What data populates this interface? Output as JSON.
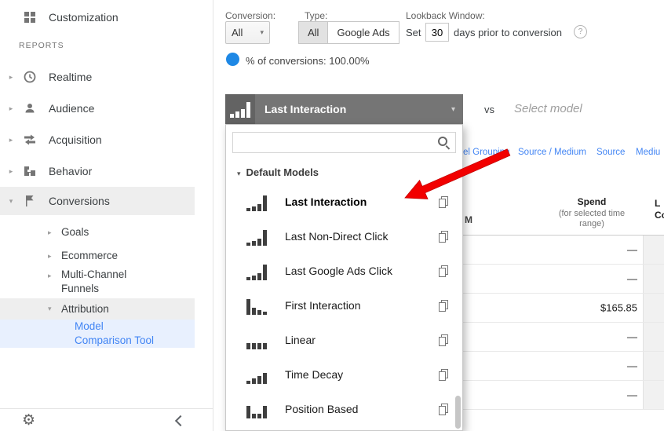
{
  "colors": {
    "link_blue": "#4285f4",
    "active_item_bg": "#e8f0fe",
    "selected_row_bg": "#eeeeee",
    "selector_header_gray": "#757575",
    "conversions_dot_blue": "#1e88e5",
    "annotation_arrow_red": "#f20000"
  },
  "sidebar": {
    "customization": "Customization",
    "reports_heading": "REPORTS",
    "realtime": "Realtime",
    "audience": "Audience",
    "acquisition": "Acquisition",
    "behavior": "Behavior",
    "conversions": "Conversions",
    "goals": "Goals",
    "ecommerce": "Ecommerce",
    "multi_channel_funnels": "Multi-Channel Funnels",
    "attribution": "Attribution",
    "model_comparison_tool": "Model Comparison Tool"
  },
  "toolbar": {
    "conversion_label": "Conversion:",
    "conversion_value": "All",
    "type_label": "Type:",
    "type_all": "All",
    "type_google_ads": "Google Ads",
    "lookback_label": "Lookback Window:",
    "set_prefix": "Set",
    "lookback_days": "30",
    "lookback_suffix": "days prior to conversion",
    "help_icon_glyph": "?",
    "pct_of_conversions": "% of conversions: 100.00%"
  },
  "model_selector": {
    "selected_model": "Last Interaction",
    "icon_bars": [
      5,
      8,
      11,
      20
    ],
    "vs_label": "vs",
    "select_model_placeholder": "Select model"
  },
  "model_dropdown": {
    "section_title": "Default Models",
    "models": [
      {
        "label": "Last Interaction",
        "bold": true,
        "icon": "last-interaction-model-icon",
        "bars": [
          4,
          6,
          9,
          20
        ]
      },
      {
        "label": "Last Non-Direct Click",
        "icon": "last-non-direct-click-model-icon",
        "bars": [
          4,
          6,
          9,
          20
        ]
      },
      {
        "label": "Last Google Ads Click",
        "icon": "last-google-ads-click-model-icon",
        "bars": [
          4,
          6,
          9,
          20
        ]
      },
      {
        "label": "First Interaction",
        "icon": "first-interaction-model-icon",
        "bars": [
          20,
          9,
          6,
          4
        ]
      },
      {
        "label": "Linear",
        "icon": "linear-model-icon",
        "bars": [
          8,
          8,
          8,
          8
        ]
      },
      {
        "label": "Time Decay",
        "icon": "time-decay-model-icon",
        "bars": [
          4,
          7,
          10,
          14
        ]
      },
      {
        "label": "Position Based",
        "icon": "position-based-model-icon",
        "bars": [
          16,
          6,
          6,
          16
        ]
      }
    ]
  },
  "table": {
    "dimension_links": [
      "el Grouping",
      "Source / Medium",
      "Source",
      "Mediu"
    ],
    "partial_left_header": "M",
    "spend_header": "Spend",
    "spend_subheader": "(for selected time range)",
    "right_partial_header_line1": "L",
    "right_partial_header_line2": "Co",
    "rows": [
      "—",
      "—",
      "$165.85",
      "—",
      "—",
      "—"
    ]
  }
}
